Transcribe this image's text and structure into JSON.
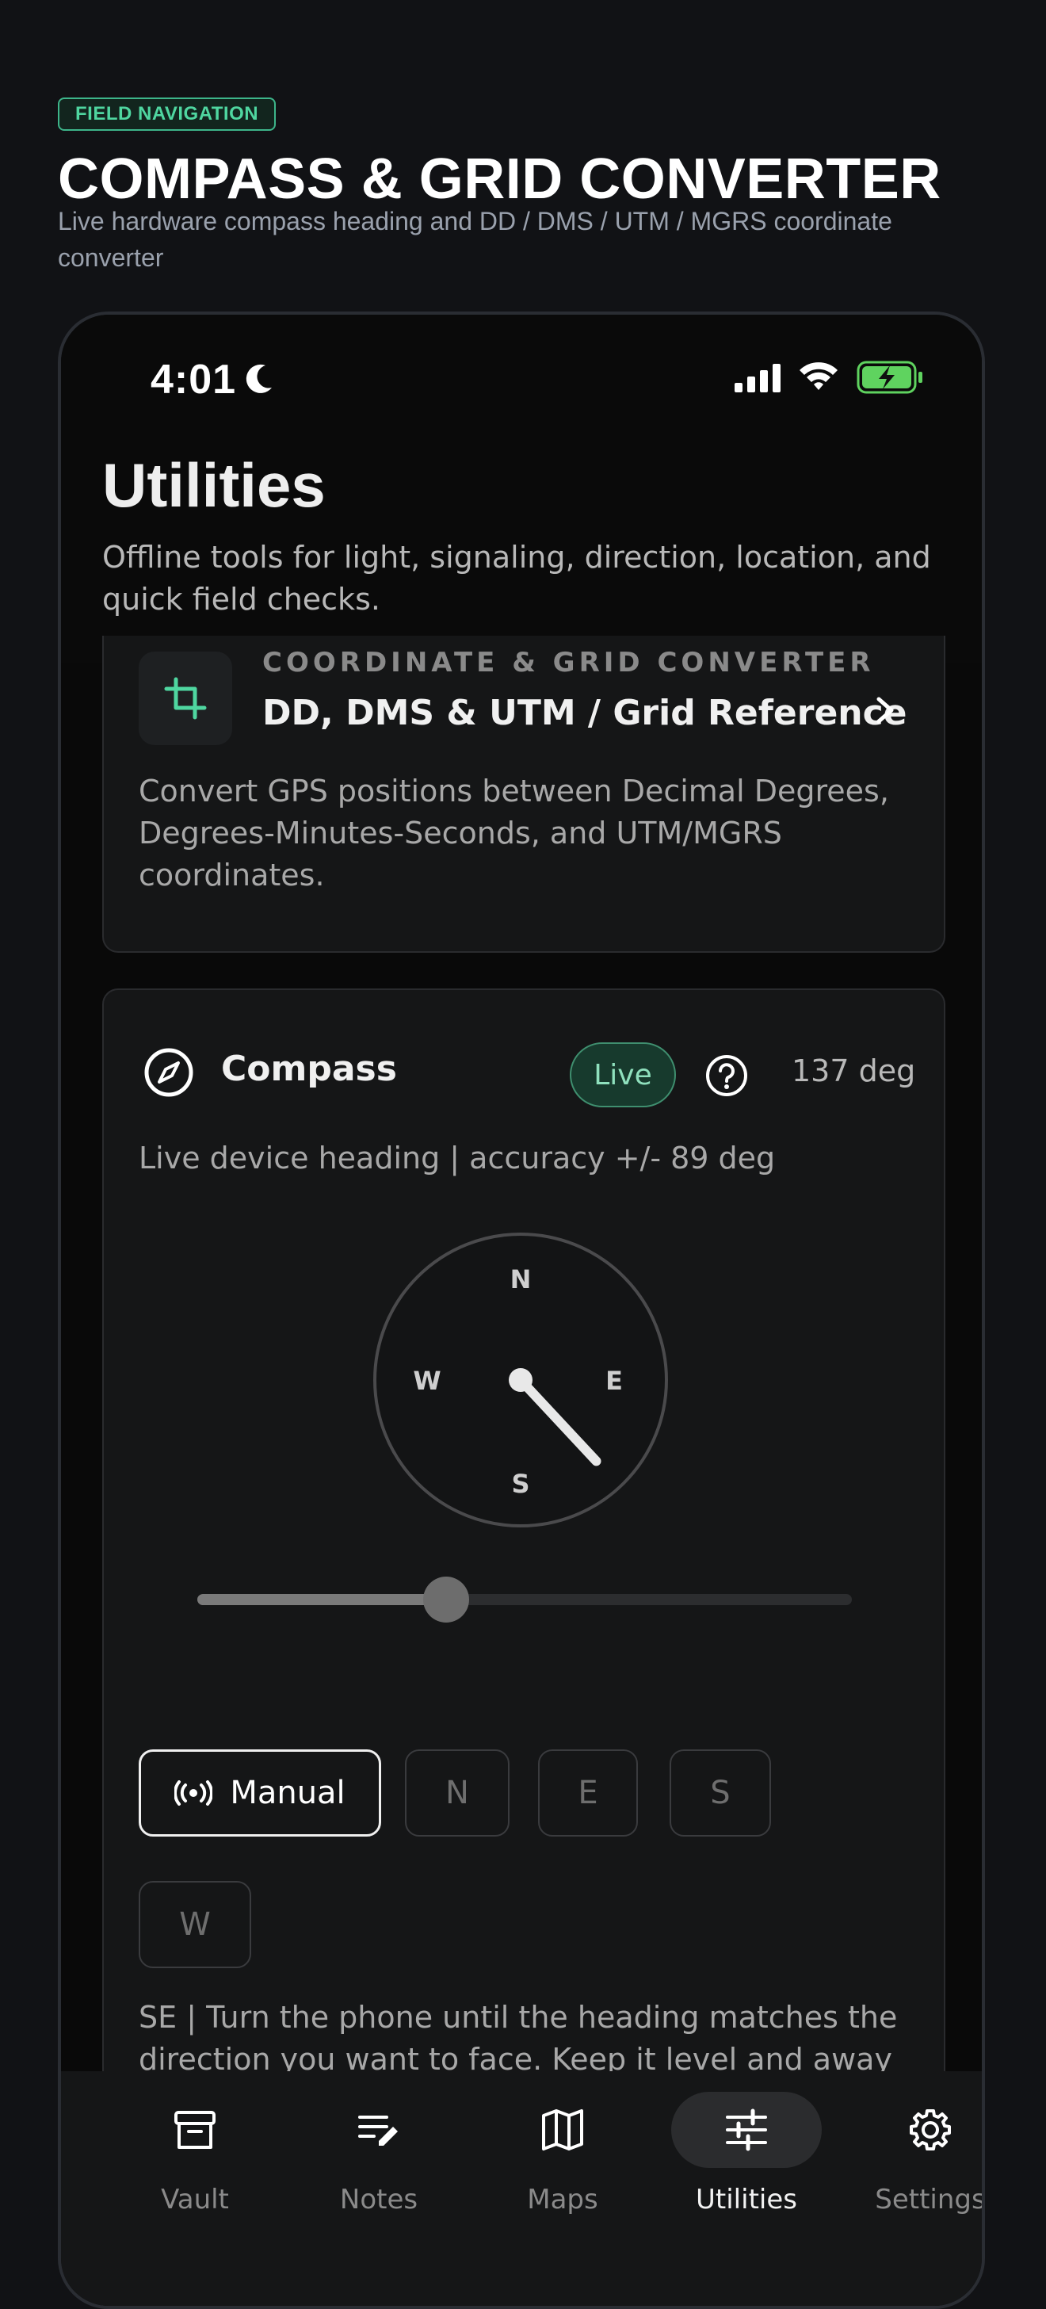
{
  "hero": {
    "tag": "FIELD NAVIGATION",
    "title": "COMPASS & GRID CONVERTER",
    "subtitle": "Live hardware compass heading and DD / DMS / UTM / MGRS coordinate converter"
  },
  "status_bar": {
    "time": "4:01",
    "icons": [
      "moon-icon",
      "signal-icon",
      "wifi-icon",
      "battery-charging-icon"
    ],
    "battery_color": "#5fd35f"
  },
  "page": {
    "title": "Utilities",
    "description": "Offline tools for light, signaling, direction, location, and quick field checks."
  },
  "converter_card": {
    "icon": "crop-icon",
    "eyebrow": "COORDINATE & GRID CONVERTER",
    "headline": "DD, DMS & UTM / Grid Reference",
    "body": "Convert GPS positions between Decimal Degrees, Degrees-Minutes-Seconds, and UTM/MGRS coordinates.",
    "accent": "#4fd6a0"
  },
  "compass_card": {
    "title": "Compass",
    "live_label": "Live",
    "heading": "137 deg",
    "heading_degrees": 137,
    "subtitle": "Live device heading | accuracy +/- 89 deg",
    "dial": {
      "n": "N",
      "e": "E",
      "s": "S",
      "w": "W"
    },
    "slider_fraction": 0.38,
    "mode_buttons": {
      "manual": "Manual",
      "n": "N",
      "e": "E",
      "s": "S",
      "w": "W"
    },
    "hint": "SE | Turn the phone until the heading matches the direction you want to face. Keep it level and away from magnets or metal."
  },
  "tabbar": {
    "tabs": [
      {
        "label": "Vault",
        "icon": "archive-icon",
        "active": false
      },
      {
        "label": "Notes",
        "icon": "notes-edit-icon",
        "active": false
      },
      {
        "label": "Maps",
        "icon": "map-icon",
        "active": false
      },
      {
        "label": "Utilities",
        "icon": "sliders-icon",
        "active": true
      },
      {
        "label": "Settings",
        "icon": "gear-icon",
        "active": false
      }
    ]
  }
}
